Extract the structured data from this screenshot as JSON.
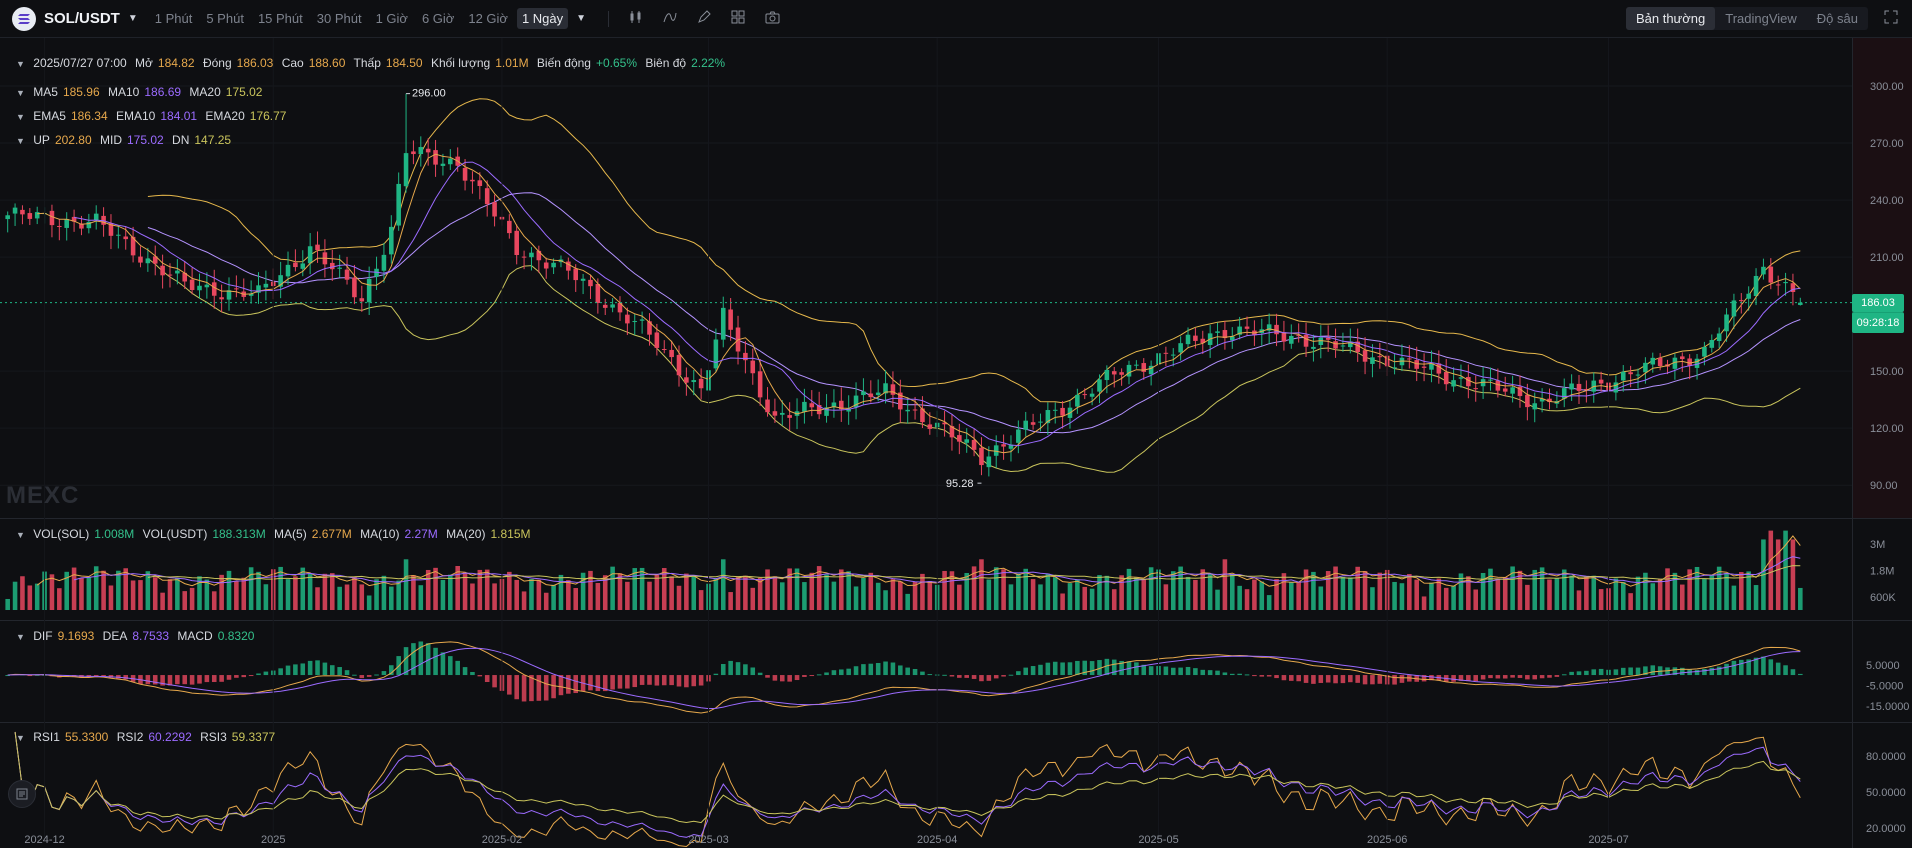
{
  "toolbar": {
    "pair": "SOL/USDT",
    "intervals": [
      "1 Phút",
      "5 Phút",
      "15 Phút",
      "30 Phút",
      "1 Giờ",
      "6 Giờ",
      "12 Giờ",
      "1 Ngày"
    ],
    "active_interval": "1 Ngày",
    "tools": [
      "candle-type-icon",
      "indicator-icon",
      "draw-icon",
      "layout-icon",
      "camera-icon"
    ],
    "views": [
      "Bản thường",
      "TradingView",
      "Độ sâu"
    ],
    "active_view": "Bản thường"
  },
  "ohlc": {
    "date": "2025/07/27 07:00",
    "open_label": "Mở",
    "open": "184.82",
    "close_label": "Đóng",
    "close": "186.03",
    "high_label": "Cao",
    "high": "188.60",
    "low_label": "Thấp",
    "low": "184.50",
    "vol_label": "Khối lượng",
    "vol": "1.01M",
    "change_label": "Biến động",
    "change": "+0.65%",
    "amp_label": "Biên độ",
    "amp": "2.22%"
  },
  "ma": {
    "ma5_label": "MA5",
    "ma5": "185.96",
    "ma10_label": "MA10",
    "ma10": "186.69",
    "ma20_label": "MA20",
    "ma20": "175.02"
  },
  "ema": {
    "ema5_label": "EMA5",
    "ema5": "186.34",
    "ema10_label": "EMA10",
    "ema10": "184.01",
    "ema20_label": "EMA20",
    "ema20": "176.77"
  },
  "boll": {
    "up_label": "UP",
    "up": "202.80",
    "mid_label": "MID",
    "mid": "175.02",
    "dn_label": "DN",
    "dn": "147.25"
  },
  "vol": {
    "vol_sol_label": "VOL(SOL)",
    "vol_sol": "1.008M",
    "vol_usdt_label": "VOL(USDT)",
    "vol_usdt": "188.313M",
    "ma5_label": "MA(5)",
    "ma5": "2.677M",
    "ma10_label": "MA(10)",
    "ma10": "2.27M",
    "ma20_label": "MA(20)",
    "ma20": "1.815M"
  },
  "macd": {
    "dif_label": "DIF",
    "dif": "9.1693",
    "dea_label": "DEA",
    "dea": "8.7533",
    "macd_label": "MACD",
    "macd": "0.8320"
  },
  "rsi": {
    "rsi1_label": "RSI1",
    "rsi1": "55.3300",
    "rsi2_label": "RSI2",
    "rsi2": "60.2292",
    "rsi3_label": "RSI3",
    "rsi3": "59.3377"
  },
  "last_price": "186.03",
  "countdown": "09:28:18",
  "watermark": "MEXC",
  "colors": {
    "up": "#1fb584",
    "down": "#e8475f",
    "ma5": "#e6a84c",
    "ma10": "#9b6bff",
    "ma20": "#c9c45c",
    "boll": "#e6b84c"
  },
  "chart_data": {
    "type": "candlestick",
    "x_start": "2024-11-26",
    "x_end": "2025-07-27",
    "price_axis": {
      "ticks": [
        300,
        270,
        240,
        210,
        150,
        120,
        90
      ],
      "ylim": [
        78,
        320
      ]
    },
    "volume_axis": {
      "ticks": [
        "3M",
        "1.8M",
        "600K"
      ]
    },
    "macd_axis": {
      "ticks": [
        "5.0000",
        "-5.0000",
        "-15.0000"
      ]
    },
    "rsi_axis": {
      "ticks": [
        "80.0000",
        "50.0000",
        "20.0000"
      ]
    },
    "x_labels": [
      "2024-12",
      "2025",
      "2025-02",
      "2025-03",
      "2025-04",
      "2025-05",
      "2025-06",
      "2025-07"
    ],
    "annotations": {
      "high": "296.00",
      "low": "95.28"
    },
    "close_anchors": [
      {
        "date": "2024-11-26",
        "close": 232
      },
      {
        "date": "2024-12-08",
        "close": 228
      },
      {
        "date": "2024-12-20",
        "close": 195
      },
      {
        "date": "2024-12-30",
        "close": 190
      },
      {
        "date": "2025-01-06",
        "close": 215
      },
      {
        "date": "2025-01-13",
        "close": 188
      },
      {
        "date": "2025-01-17",
        "close": 225
      },
      {
        "date": "2025-01-19",
        "close": 265
      },
      {
        "date": "2025-01-26",
        "close": 260
      },
      {
        "date": "2025-02-03",
        "close": 215
      },
      {
        "date": "2025-02-10",
        "close": 202
      },
      {
        "date": "2025-02-20",
        "close": 172
      },
      {
        "date": "2025-02-28",
        "close": 140
      },
      {
        "date": "2025-03-03",
        "close": 178
      },
      {
        "date": "2025-03-10",
        "close": 125
      },
      {
        "date": "2025-03-25",
        "close": 139
      },
      {
        "date": "2025-04-07",
        "close": 105
      },
      {
        "date": "2025-04-25",
        "close": 148
      },
      {
        "date": "2025-05-10",
        "close": 172
      },
      {
        "date": "2025-05-20",
        "close": 168
      },
      {
        "date": "2025-06-05",
        "close": 152
      },
      {
        "date": "2025-06-22",
        "close": 134
      },
      {
        "date": "2025-07-05",
        "close": 150
      },
      {
        "date": "2025-07-14",
        "close": 160
      },
      {
        "date": "2025-07-22",
        "close": 205
      },
      {
        "date": "2025-07-27",
        "close": 186.03
      }
    ],
    "ohlc_last": {
      "date": "2025/07/27",
      "open": 184.82,
      "high": 188.6,
      "low": 184.5,
      "close": 186.03,
      "volume": "1.01M"
    }
  }
}
